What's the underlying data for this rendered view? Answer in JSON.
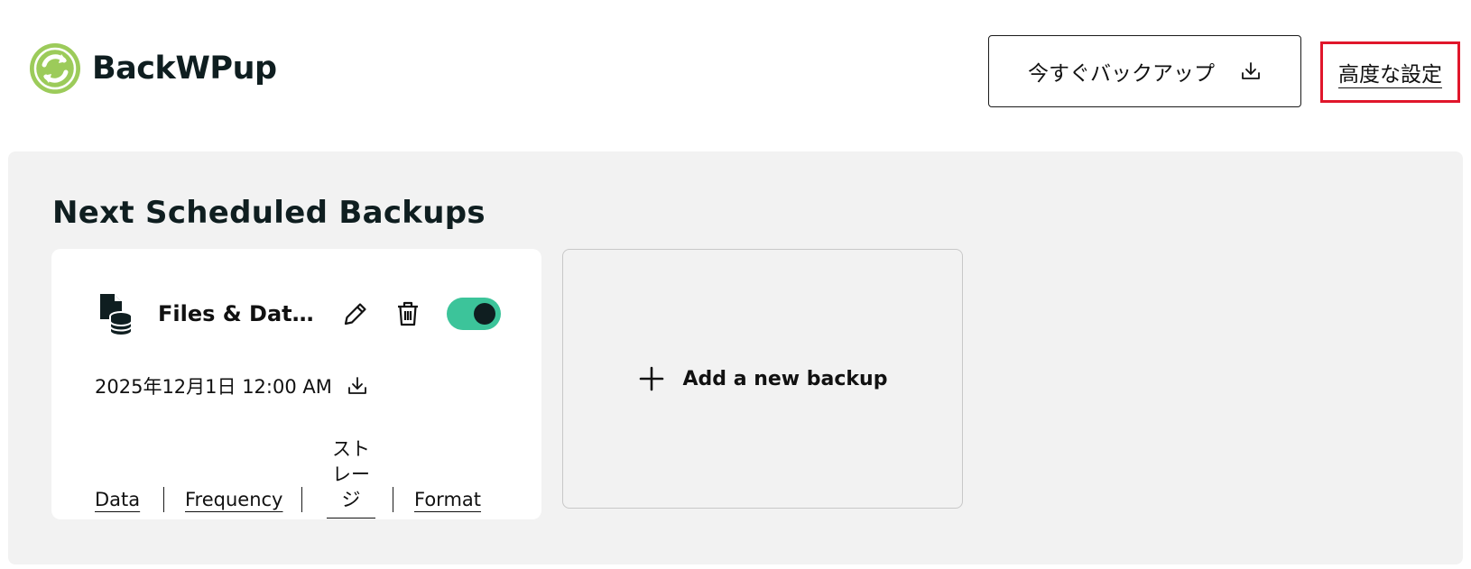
{
  "header": {
    "logo_text": "BackWPup",
    "backup_now_label": "今すぐバックアップ",
    "advanced_settings_label": "高度な設定",
    "highlight_color": "#e0162b"
  },
  "panel": {
    "title": "Next Scheduled Backups",
    "card": {
      "title": "Files & Data...",
      "enabled": true,
      "toggle_color": "#3cc49a",
      "next_run": "2025年12月1日 12:00 AM",
      "links": {
        "data": "Data",
        "frequency": "Frequency",
        "storage": "ストレージ",
        "format": "Format"
      }
    },
    "add_card": {
      "label": "Add a new backup"
    }
  },
  "icons": {
    "logo": "backwpup-logo-icon",
    "download": "download-icon",
    "file_database": "file-database-icon",
    "edit": "pencil-icon",
    "delete": "trash-icon",
    "add": "plus-icon"
  }
}
